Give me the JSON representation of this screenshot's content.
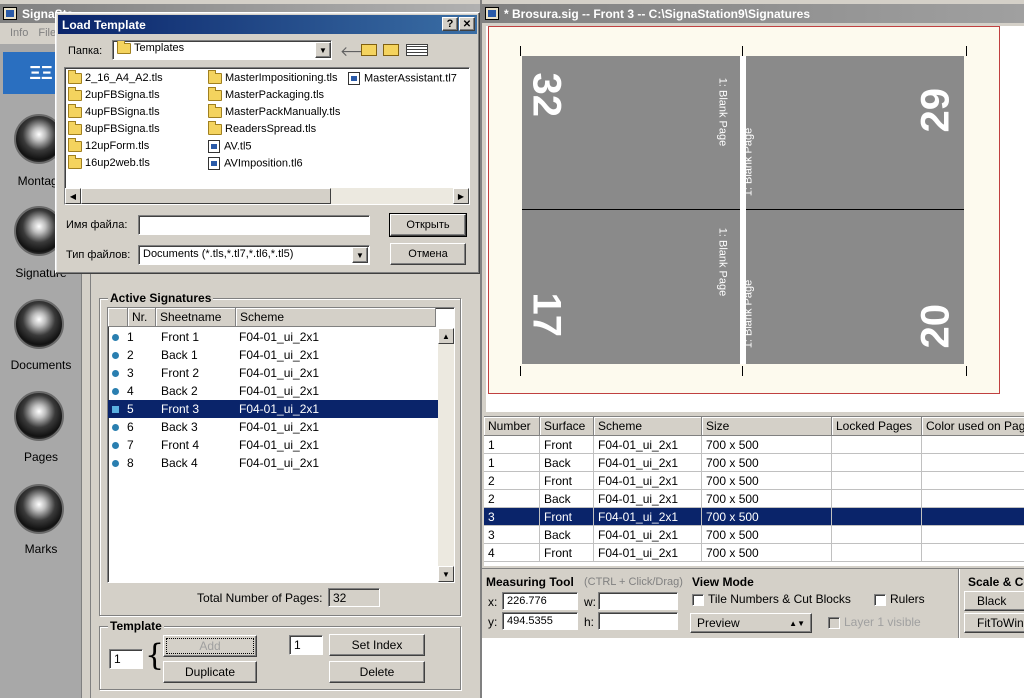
{
  "background_app": {
    "title": "SignaSta...",
    "menu": [
      "Info",
      "File"
    ]
  },
  "nav": [
    {
      "label": "Montage"
    },
    {
      "label": "Signature"
    },
    {
      "label": "Documents"
    },
    {
      "label": "Pages"
    },
    {
      "label": "Marks"
    }
  ],
  "dialog": {
    "title": "Load Template",
    "help": "?",
    "close": "✕",
    "folder_label": "Папка:",
    "folder_value": "Templates",
    "files_col1": [
      "2_16_A4_A2.tls",
      "2upFBSigna.tls",
      "4upFBSigna.tls",
      "8upFBSigna.tls",
      "12upForm.tls",
      "16up2web.tls"
    ],
    "files_col2": [
      "MasterImpositioning.tls",
      "MasterPackaging.tls",
      "MasterPackManually.tls",
      "ReadersSpread.tls",
      "AV.tl5",
      "AVImposition.tl6"
    ],
    "files_col3": [
      "MasterAssistant.tl7"
    ],
    "filename_label": "Имя файла:",
    "filename_value": "",
    "filetype_label": "Тип файлов:",
    "filetype_value": "Documents (*.tls,*.tl7,*.tl6,*.tl5)",
    "open_button": "Открыть",
    "cancel_button": "Отмена"
  },
  "active_signatures": {
    "title": "Active Signatures",
    "columns": [
      "Nr.",
      "Sheetname",
      "Scheme"
    ],
    "rows": [
      {
        "nr": "1",
        "name": "Front 1",
        "scheme": "F04-01_ui_2x1"
      },
      {
        "nr": "2",
        "name": "Back 1",
        "scheme": "F04-01_ui_2x1"
      },
      {
        "nr": "3",
        "name": "Front 2",
        "scheme": "F04-01_ui_2x1"
      },
      {
        "nr": "4",
        "name": "Back 2",
        "scheme": "F04-01_ui_2x1"
      },
      {
        "nr": "5",
        "name": "Front 3",
        "scheme": "F04-01_ui_2x1"
      },
      {
        "nr": "6",
        "name": "Back 3",
        "scheme": "F04-01_ui_2x1"
      },
      {
        "nr": "7",
        "name": "Front 4",
        "scheme": "F04-01_ui_2x1"
      },
      {
        "nr": "8",
        "name": "Back 4",
        "scheme": "F04-01_ui_2x1"
      }
    ],
    "selected_index": 4,
    "total_label": "Total Number of Pages:",
    "total_value": "32"
  },
  "template": {
    "title": "Template",
    "count_value": "1",
    "add_button": "Add",
    "duplicate_button": "Duplicate",
    "index_value": "1",
    "set_index_button": "Set Index",
    "delete_button": "Delete"
  },
  "doc_window": {
    "title": "* Brosura.sig  --  Front 3 -- C:\\SignaStation9\\Signatures"
  },
  "preview": {
    "pages": [
      {
        "num": "32",
        "label": "1: Blank Page"
      },
      {
        "num": "29",
        "label": "1: Blank Page"
      },
      {
        "num": "17",
        "label": "1: Blank Page"
      },
      {
        "num": "20",
        "label": "1: Blank Page"
      }
    ]
  },
  "sheets_table": {
    "columns": [
      "Number",
      "Surface",
      "Scheme",
      "Size",
      "Locked Pages",
      "Color used on Pag"
    ],
    "rows": [
      {
        "number": "1",
        "surface": "Front",
        "scheme": "F04-01_ui_2x1",
        "size": "700 x 500"
      },
      {
        "number": "1",
        "surface": "Back",
        "scheme": "F04-01_ui_2x1",
        "size": "700 x 500"
      },
      {
        "number": "2",
        "surface": "Front",
        "scheme": "F04-01_ui_2x1",
        "size": "700 x 500"
      },
      {
        "number": "2",
        "surface": "Back",
        "scheme": "F04-01_ui_2x1",
        "size": "700 x 500"
      },
      {
        "number": "3",
        "surface": "Front",
        "scheme": "F04-01_ui_2x1",
        "size": "700 x 500"
      },
      {
        "number": "3",
        "surface": "Back",
        "scheme": "F04-01_ui_2x1",
        "size": "700 x 500"
      },
      {
        "number": "4",
        "surface": "Front",
        "scheme": "F04-01_ui_2x1",
        "size": "700 x 500"
      }
    ],
    "selected_index": 4
  },
  "measuring": {
    "title": "Measuring Tool",
    "hint": "(CTRL + Click/Drag)",
    "x_label": "x:",
    "x_value": "226.776",
    "y_label": "y:",
    "y_value": "494.5355",
    "w_label": "w:",
    "w_value": "",
    "h_label": "h:",
    "h_value": ""
  },
  "view_mode": {
    "title": "View Mode",
    "tile_numbers_label": "Tile Numbers & Cut Blocks",
    "rulers_label": "Rulers",
    "mode_value": "Preview",
    "layer_label": "Layer 1 visible"
  },
  "scale": {
    "title": "Scale & Co",
    "black_button": "Black",
    "fit_button": "FitToWin"
  }
}
